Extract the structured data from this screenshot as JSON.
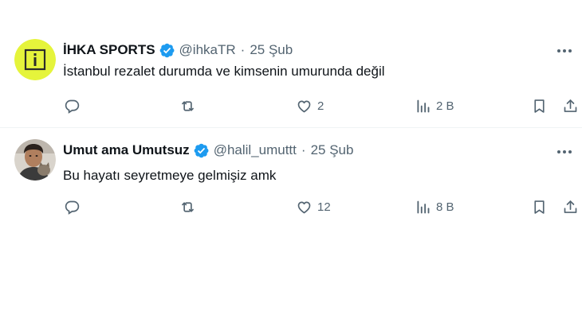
{
  "tweets": [
    {
      "display_name": "İHKA SPORTS",
      "handle": "@ihkaTR",
      "date": "25 Şub",
      "text": "İstanbul rezalet durumda ve kimsenin umurunda değil",
      "likes": "2",
      "views": "2 B",
      "avatar_icon": "ihka-logo-icon",
      "avatar_color": "#e5f43b"
    },
    {
      "display_name": "Umut ama Umutsuz",
      "handle": "@halil_umuttt",
      "date": "25 Şub",
      "text": "Bu hayatı seyretmeye gelmişiz amk",
      "likes": "12",
      "views": "8 B",
      "avatar_icon": "user-photo-avatar"
    }
  ],
  "separator": "·",
  "colors": {
    "verified": "#1d9bf0",
    "secondary_text": "#536471",
    "primary_text": "#0f1419",
    "divider": "#eff3f4"
  },
  "icons": [
    "reply-icon",
    "retweet-icon",
    "like-icon",
    "views-icon",
    "bookmark-icon",
    "share-icon",
    "more-icon",
    "verified-badge-icon"
  ]
}
